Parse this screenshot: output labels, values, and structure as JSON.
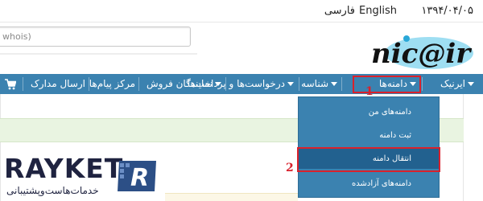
{
  "topbar": {
    "date": "۱۳۹۴/۰۴/۰۵",
    "lang_en": "English",
    "lang_fa": "فارسی"
  },
  "search": {
    "placeholder": "whois)"
  },
  "logo": {
    "text": "nic@ir",
    "icon": "nic-ir-logo"
  },
  "nav": {
    "items": [
      {
        "label": "ایرنیک",
        "has_caret": true
      },
      {
        "label": "دامنه‌ها",
        "has_caret": true
      },
      {
        "label": "شناسه",
        "has_caret": true
      },
      {
        "label": "درخواست‌ها و پرداخت‌ها",
        "has_caret": true
      },
      {
        "label": "نمایندگان فروش",
        "has_caret": true
      },
      {
        "label": "مرکز پیام‌ها",
        "has_caret": false
      },
      {
        "label": "ارسال مدارک",
        "has_caret": false
      }
    ],
    "cart_icon": "cart-icon"
  },
  "markers": {
    "one": "1",
    "two": "2"
  },
  "dropdown": {
    "items": [
      {
        "label": "دامنه‌های من"
      },
      {
        "label": "ثبت دامنه"
      },
      {
        "label": "انتقال دامنه"
      },
      {
        "label": "دامنه‌های آزادشده"
      }
    ],
    "highlighted_index": 2
  },
  "watermark": {
    "title": "RAYKET",
    "subtitle": "خدمات‌هاست‌وپشتیبانی",
    "badge_letter": "R"
  },
  "colors": {
    "nav": "#3b82b0",
    "dropdown_highlight": "#22618f",
    "annotation": "#d9212c",
    "panel": "#e9f4e1"
  }
}
